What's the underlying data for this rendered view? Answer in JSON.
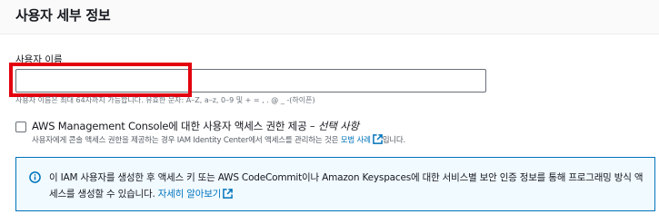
{
  "panel": {
    "title": "사용자 세부 정보"
  },
  "username": {
    "label": "사용자 이름",
    "value": "",
    "placeholder": "",
    "constraint": "사용자 이름은 최대 64자까지 가능합니다. 유효한 문자: A–Z, a–z, 0–9 및 + = , . @ _ -(하이픈)"
  },
  "console_access": {
    "label": "AWS Management Console에 대한 사용자 액세스 권한 제공 –",
    "optional_label": "선택 사항",
    "checked": false,
    "description": "사용자에게 콘솔 액세스 권한을 제공하는 경우 IAM Identity Center에서 액세스를 관리하는 것은",
    "link_text": "모범 사례",
    "description_suffix": "입니다."
  },
  "info": {
    "text": "이 IAM 사용자를 생성한 후 액세스 키 또는 AWS CodeCommit이나 Amazon Keyspaces에 대한 서비스별 보안 인증 정보를 통해 프로그래밍 방식 액세스를 생성할 수 있습니다.",
    "link_text": "자세히 알아보기"
  },
  "colors": {
    "link": "#0073bb",
    "highlight": "#e3000f",
    "info_background": "#f1faff"
  },
  "icons": {
    "external_link": "external-link-icon",
    "info": "info-icon"
  }
}
